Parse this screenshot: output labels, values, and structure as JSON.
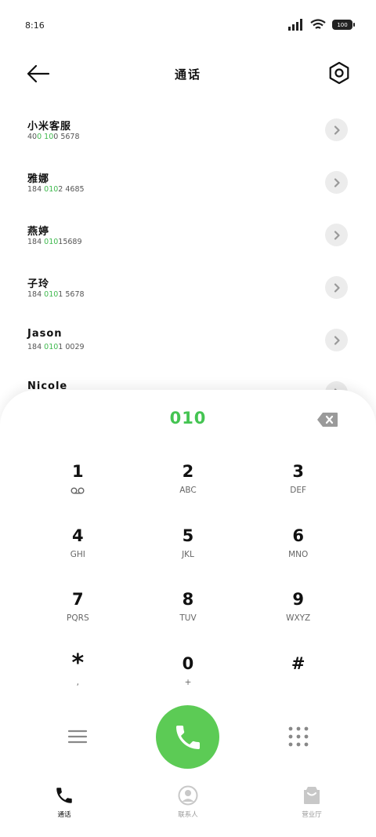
{
  "status_bar": {
    "time": "8:16",
    "battery": "100"
  },
  "header": {
    "title": "通话"
  },
  "contacts": [
    {
      "name": "小米客服",
      "number_parts": [
        "40",
        "0 10",
        "0 5678"
      ]
    },
    {
      "name": "雅娜",
      "number_parts": [
        "184 ",
        "010",
        "2 4685"
      ]
    },
    {
      "name": "燕婷",
      "number_parts": [
        "184 ",
        "010",
        "15689"
      ]
    },
    {
      "name": "子玲",
      "number_parts": [
        "184 ",
        "010",
        "1 5678"
      ]
    },
    {
      "name": "Jason",
      "number_parts": [
        "184 ",
        "010",
        "1 0029"
      ]
    },
    {
      "name": "Nicole",
      "number_parts": [
        "",
        "",
        ""
      ]
    }
  ],
  "dialer": {
    "dialed": "010"
  },
  "keys": [
    {
      "digit": "1",
      "letters": ""
    },
    {
      "digit": "2",
      "letters": "ABC"
    },
    {
      "digit": "3",
      "letters": "DEF"
    },
    {
      "digit": "4",
      "letters": "GHI"
    },
    {
      "digit": "5",
      "letters": "JKL"
    },
    {
      "digit": "6",
      "letters": "MNO"
    },
    {
      "digit": "7",
      "letters": "PQRS"
    },
    {
      "digit": "8",
      "letters": "TUV"
    },
    {
      "digit": "9",
      "letters": "WXYZ"
    },
    {
      "digit": "*",
      "letters": ","
    },
    {
      "digit": "0",
      "letters": "+"
    },
    {
      "digit": "#",
      "letters": ""
    }
  ],
  "nav": {
    "calls": "通话",
    "contacts": "联系人",
    "store": "营业厅"
  },
  "colors": {
    "accent": "#44c452",
    "call_button": "#5ccb55"
  }
}
